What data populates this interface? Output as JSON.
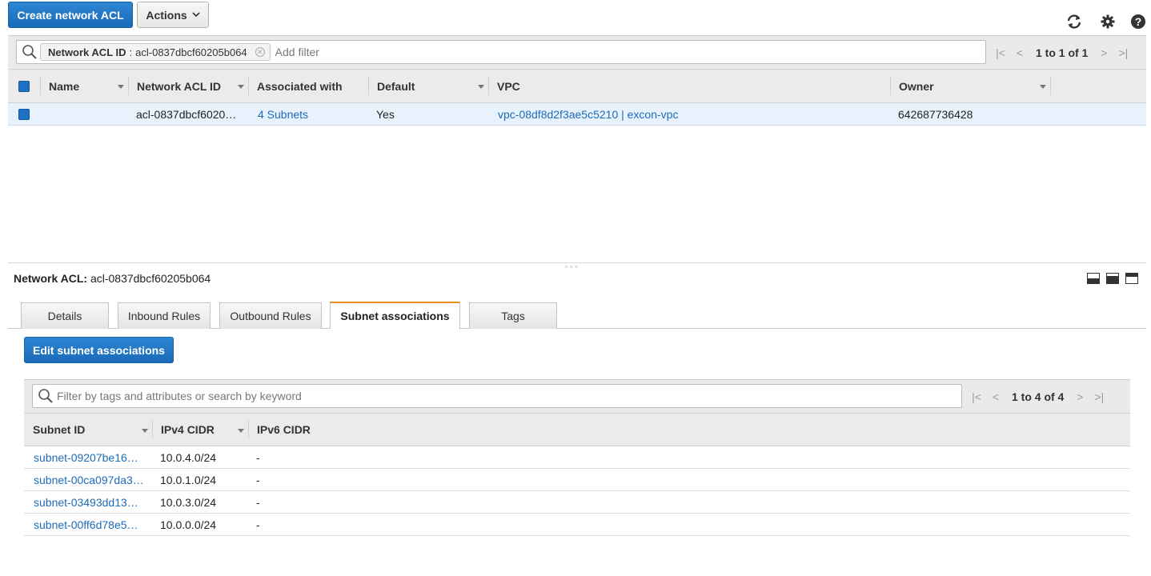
{
  "toolbar": {
    "create_label": "Create network ACL",
    "actions_label": "Actions"
  },
  "filter": {
    "chip_key": "Network ACL ID",
    "chip_sep": ":",
    "chip_value": "acl-0837dbcf60205b064",
    "placeholder": "Add filter",
    "pager_text": "1 to 1 of 1"
  },
  "acl_table": {
    "columns": [
      "Name",
      "Network ACL ID",
      "Associated with",
      "Default",
      "VPC",
      "Owner"
    ],
    "rows": [
      {
        "name": "",
        "acl_id": "acl-0837dbcf6020…",
        "associated": "4 Subnets",
        "default": "Yes",
        "vpc": "vpc-08df8d2f3ae5c5210 | excon-vpc",
        "owner": "642687736428"
      }
    ]
  },
  "details": {
    "title_label": "Network ACL:",
    "title_value": "acl-0837dbcf60205b064",
    "tabs": [
      "Details",
      "Inbound Rules",
      "Outbound Rules",
      "Subnet associations",
      "Tags"
    ],
    "active_tab": "Subnet associations",
    "edit_label": "Edit subnet associations",
    "search_placeholder": "Filter by tags and attributes or search by keyword",
    "pager_text": "1 to 4 of 4",
    "columns": [
      "Subnet ID",
      "IPv4 CIDR",
      "IPv6 CIDR"
    ],
    "rows": [
      {
        "subnet": "subnet-09207be16…",
        "ipv4": "10.0.4.0/24",
        "ipv6": "-"
      },
      {
        "subnet": "subnet-00ca097da3…",
        "ipv4": "10.0.1.0/24",
        "ipv6": "-"
      },
      {
        "subnet": "subnet-03493dd13…",
        "ipv4": "10.0.3.0/24",
        "ipv6": "-"
      },
      {
        "subnet": "subnet-00ff6d78e5…",
        "ipv4": "10.0.0.0/24",
        "ipv6": "-"
      }
    ]
  },
  "icons": {
    "refresh": "refresh-icon",
    "settings": "gear-icon",
    "help": "help-icon"
  },
  "colors": {
    "primary": "#1a6bb8",
    "link": "#1d6cb7",
    "active_tab": "#e88c1e",
    "selected_row": "#e8f2fc"
  }
}
